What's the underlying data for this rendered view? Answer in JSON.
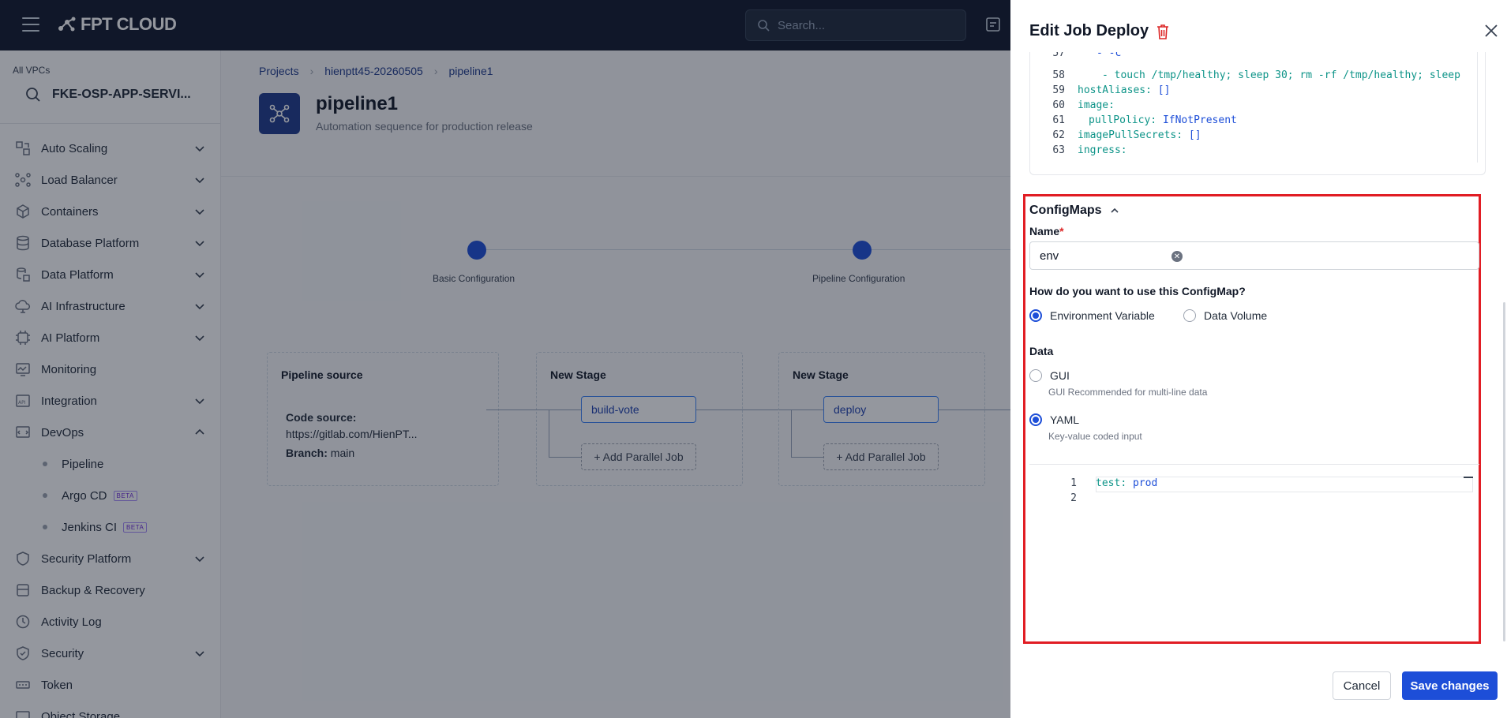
{
  "topbar": {
    "brand": "FPT CLOUD",
    "search_placeholder": "Search..."
  },
  "sidebar": {
    "vpc_label": "All VPCs",
    "vpc_name": "FKE-OSP-APP-SERVI...",
    "items": [
      {
        "label": "Auto Scaling",
        "icon": "auto-scaling-icon",
        "expandable": true
      },
      {
        "label": "Load Balancer",
        "icon": "load-balancer-icon",
        "expandable": true
      },
      {
        "label": "Containers",
        "icon": "containers-icon",
        "expandable": true
      },
      {
        "label": "Database Platform",
        "icon": "database-icon",
        "expandable": true
      },
      {
        "label": "Data Platform",
        "icon": "data-platform-icon",
        "expandable": true
      },
      {
        "label": "AI Infrastructure",
        "icon": "ai-infra-icon",
        "expandable": true
      },
      {
        "label": "AI Platform",
        "icon": "ai-platform-icon",
        "expandable": true
      },
      {
        "label": "Monitoring",
        "icon": "monitoring-icon",
        "expandable": false
      },
      {
        "label": "Integration",
        "icon": "integration-icon",
        "expandable": true
      },
      {
        "label": "DevOps",
        "icon": "devops-icon",
        "expandable": true,
        "expanded": true
      }
    ],
    "devops_sub": [
      {
        "label": "Pipeline",
        "badge": ""
      },
      {
        "label": "Argo CD",
        "badge": "BETA"
      },
      {
        "label": "Jenkins CI",
        "badge": "BETA"
      }
    ],
    "items_after": [
      {
        "label": "Security Platform",
        "icon": "security-platform-icon",
        "expandable": true
      },
      {
        "label": "Backup & Recovery",
        "icon": "backup-icon",
        "expandable": false
      },
      {
        "label": "Activity Log",
        "icon": "activity-log-icon",
        "expandable": false
      },
      {
        "label": "Security",
        "icon": "security-icon",
        "expandable": true
      },
      {
        "label": "Token",
        "icon": "token-icon",
        "expandable": false
      },
      {
        "label": "Object Storage",
        "icon": "object-storage-icon",
        "expandable": false
      }
    ]
  },
  "main": {
    "breadcrumb": [
      "Projects",
      "hienptt45-20260505",
      "pipeline1"
    ],
    "title": "pipeline1",
    "subtitle": "Automation sequence for production release",
    "steps": [
      "Basic Configuration",
      "Pipeline Configuration"
    ],
    "source": {
      "title": "Pipeline source",
      "code_source_label": "Code source:",
      "code_source_value": "https://gitlab.com/HienPT...",
      "branch_label": "Branch:",
      "branch_value": "main"
    },
    "stages": [
      {
        "title": "New Stage",
        "job": "build-vote",
        "add_label": "+ Add Parallel Job"
      },
      {
        "title": "New Stage",
        "job": "deploy",
        "add_label": "+ Add Parallel Job"
      }
    ]
  },
  "drawer": {
    "title": "Edit Job Deploy",
    "code_lines": [
      {
        "n": "57",
        "text": "  - -c",
        "indent": 2
      },
      {
        "n": "58",
        "key": "- touch /tmp/healthy; sleep 30; rm -rf /tmp/healthy; sleep",
        "indent": 2
      },
      {
        "n": "59",
        "key": "hostAliases",
        "value": "[]",
        "indent": 0
      },
      {
        "n": "60",
        "key": "image",
        "value": "",
        "indent": 0
      },
      {
        "n": "61",
        "key": "pullPolicy",
        "value": "IfNotPresent",
        "indent": 1
      },
      {
        "n": "62",
        "key": "imagePullSecrets",
        "value": "[]",
        "indent": 0
      },
      {
        "n": "63",
        "key": "ingress",
        "value": "",
        "indent": 0
      }
    ],
    "configmaps": {
      "title": "ConfigMaps",
      "name_label": "Name",
      "name_required": "*",
      "name_value": "env",
      "usage_question": "How do you want to use this ConfigMap?",
      "usage_options": [
        "Environment Variable",
        "Data Volume"
      ],
      "usage_selected": "Environment Variable",
      "data_label": "Data",
      "data_options": [
        {
          "label": "GUI",
          "help": "GUI Recommended for multi-line data"
        },
        {
          "label": "YAML",
          "help": "Key-value coded input"
        }
      ],
      "data_selected": "YAML",
      "yaml_lines": [
        {
          "n": "1",
          "key": "test",
          "value": "prod"
        },
        {
          "n": "2",
          "key": "",
          "value": ""
        }
      ]
    },
    "cancel_label": "Cancel",
    "save_label": "Save changes"
  },
  "colors": {
    "accent": "#1d4ed8",
    "highlight_border": "#e11d24",
    "topbar": "#0f172a"
  }
}
